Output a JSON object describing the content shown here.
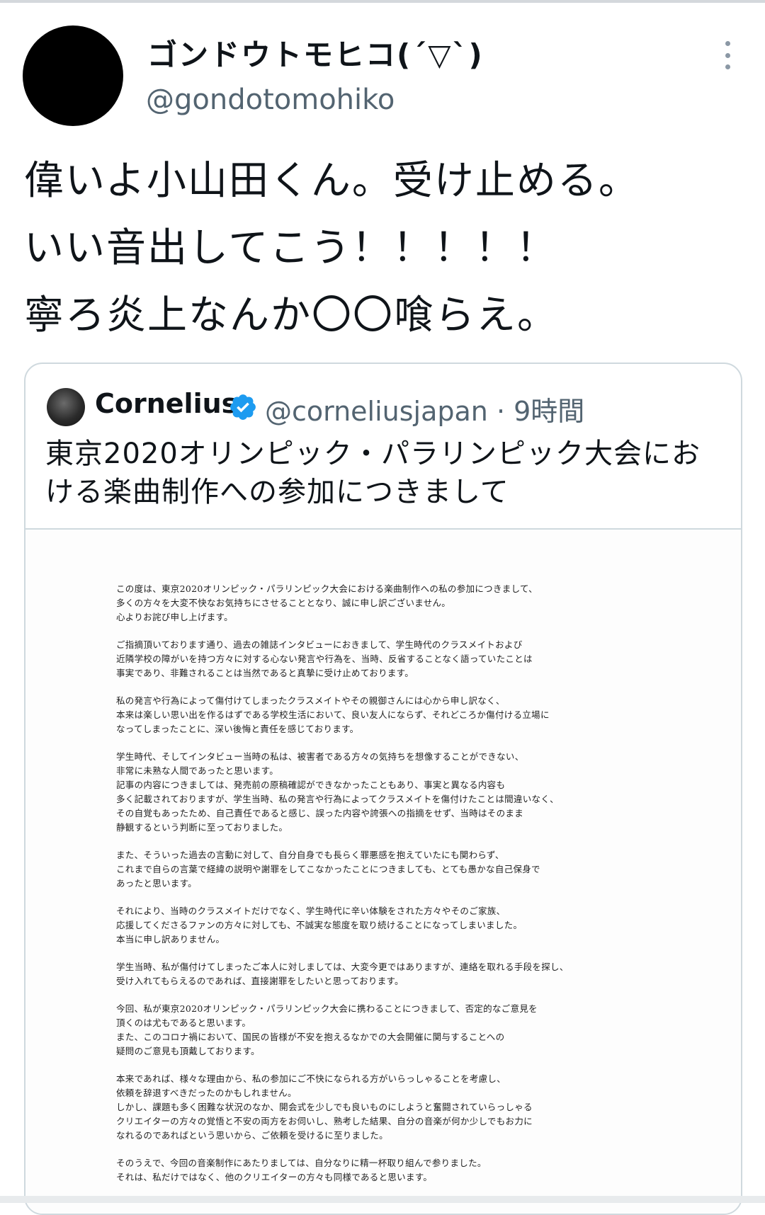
{
  "tweet": {
    "author": {
      "display_name": "ゴンドウトモヒコ(´▽`)",
      "handle": "@gondotomohiko"
    },
    "text_lines": [
      "偉いよ小山田くん。受け止める。",
      "いい音出してこう！！！！！",
      "寧ろ炎上なんか〇〇喰らえ。"
    ],
    "more_icon": "more-vertical-icon"
  },
  "quote": {
    "author": {
      "display_name": "Cornelius",
      "handle_time": "@corneliusjapan · 9時間",
      "verified_icon": "verified-badge-icon",
      "verified_color": "#1d9bf0"
    },
    "text": "東京2020オリンピック・パラリンピック大会における楽曲制作への参加につきまして",
    "document": {
      "paragraphs": [
        [
          "この度は、東京2020オリンピック・パラリンピック大会における楽曲制作への私の参加につきまして、",
          "多くの方々を大変不快なお気持ちにさせることとなり、誠に申し訳ございません。",
          "心よりお詫び申し上げます。"
        ],
        [
          "ご指摘頂いております通り、過去の雑誌インタビューにおきまして、学生時代のクラスメイトおよび",
          "近隣学校の障がいを持つ方々に対する心ない発言や行為を、当時、反省することなく語っていたことは",
          "事実であり、非難されることは当然であると真摯に受け止めております。"
        ],
        [
          "私の発言や行為によって傷付けてしまったクラスメイトやその親御さんには心から申し訳なく、",
          "本来は楽しい思い出を作るはずである学校生活において、良い友人にならず、それどころか傷付ける立場に",
          "なってしまったことに、深い後悔と責任を感じております。"
        ],
        [
          "学生時代、そしてインタビュー当時の私は、被害者である方々の気持ちを想像することができない、",
          "非常に未熟な人間であったと思います。",
          "記事の内容につきましては、発売前の原稿確認ができなかったこともあり、事実と異なる内容も",
          "多く記載されておりますが、学生当時、私の発言や行為によってクラスメイトを傷付けたことは間違いなく、",
          "その自覚もあったため、自己責任であると感じ、誤った内容や誇張への指摘をせず、当時はそのまま",
          "静観するという判断に至っておりました。"
        ],
        [
          "また、そういった過去の言動に対して、自分自身でも長らく罪悪感を抱えていたにも関わらず、",
          "これまで自らの言葉で経緯の説明や謝罪をしてこなかったことにつきましても、とても愚かな自己保身で",
          "あったと思います。"
        ],
        [
          "それにより、当時のクラスメイトだけでなく、学生時代に辛い体験をされた方々やそのご家族、",
          "応援してくださるファンの方々に対しても、不誠実な態度を取り続けることになってしまいました。",
          "本当に申し訳ありません。"
        ],
        [
          "学生当時、私が傷付けてしまったご本人に対しましては、大変今更ではありますが、連絡を取れる手段を探し、",
          "受け入れてもらえるのであれば、直接謝罪をしたいと思っております。"
        ],
        [
          "今回、私が東京2020オリンピック・パラリンピック大会に携わることにつきまして、否定的なご意見を",
          "頂くのは尤もであると思います。",
          "また、このコロナ禍において、国民の皆様が不安を抱えるなかでの大会開催に関与することへの",
          "疑問のご意見も頂戴しております。"
        ],
        [
          "本来であれば、様々な理由から、私の参加にご不快になられる方がいらっしゃることを考慮し、",
          "依頼を辞退すべきだったのかもしれません。",
          "しかし、課題も多く困難な状況のなか、開会式を少しでも良いものにしようと奮闘されていらっしゃる",
          "クリエイターの方々の覚悟と不安の両方をお伺いし、熟考した結果、自分の音楽が何か少しでもお力に",
          "なれるのであればという思いから、ご依頼を受けるに至りました。"
        ],
        [
          "そのうえで、今回の音楽制作にあたりましては、自分なりに精一杯取り組んで参りました。",
          "それは、私だけではなく、他のクリエイターの方々も同様であると思います。"
        ]
      ]
    }
  }
}
